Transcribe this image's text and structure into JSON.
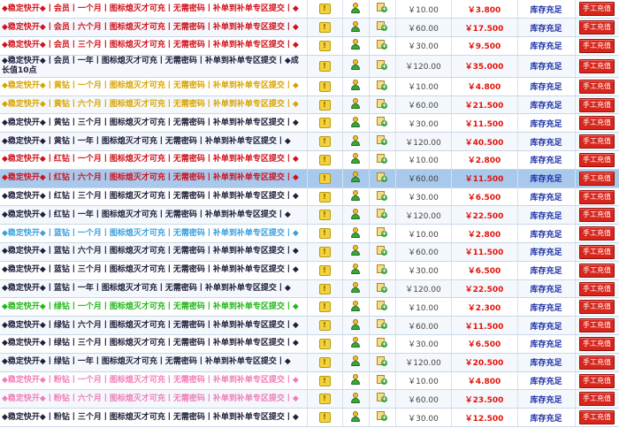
{
  "window": {
    "title": ""
  },
  "stock_status": "库存充足",
  "recharge_button_label": "手工充值",
  "colors": {
    "red": "#d0121c",
    "gold": "#d9a400",
    "dark": "#20203c",
    "sky": "#3aa0de",
    "green": "#22b818",
    "pink": "#f07fb8",
    "sell_price": "#e0140a",
    "stock": "#1a2fa8",
    "selected_row": "#a8c8ec",
    "button": "#d8261c"
  },
  "icons": {
    "notice": "exclamation-icon",
    "user": "user-icon",
    "add": "add-document-icon"
  },
  "rows": [
    {
      "name": "◆稳定快开◆丨会员丨一个月丨图标熄灭才可充丨无需密码丨补单到补单专区提交丨◆",
      "color": "red",
      "price": "￥10.00",
      "sell": "￥3.800"
    },
    {
      "name": "◆稳定快开◆丨会员丨六个月丨图标熄灭才可充丨无需密码丨补单到补单专区提交丨◆",
      "color": "red",
      "price": "￥60.00",
      "sell": "￥17.500"
    },
    {
      "name": "◆稳定快开◆丨会员丨三个月丨图标熄灭才可充丨无需密码丨补单到补单专区提交丨◆",
      "color": "red",
      "price": "￥30.00",
      "sell": "￥9.500"
    },
    {
      "name": "◆稳定快开◆丨会员丨一年丨图标熄灭才可充丨无需密码丨补单到补单专区提交丨◆成长值10点",
      "color": "dark",
      "price": "￥120.00",
      "sell": "￥35.000",
      "tall": true
    },
    {
      "name": "◆稳定快开◆丨黄钻丨一个月丨图标熄灭才可充丨无需密码丨补单到补单专区提交丨◆",
      "color": "gold",
      "price": "￥10.00",
      "sell": "￥4.800"
    },
    {
      "name": "◆稳定快开◆丨黄钻丨六个月丨图标熄灭才可充丨无需密码丨补单到补单专区提交丨◆",
      "color": "gold",
      "price": "￥60.00",
      "sell": "￥21.500"
    },
    {
      "name": "◆稳定快开◆丨黄钻丨三个月丨图标熄灭才可充丨无需密码丨补单到补单专区提交丨◆",
      "color": "dark",
      "price": "￥30.00",
      "sell": "￥11.500"
    },
    {
      "name": "◆稳定快开◆丨黄钻丨一年丨图标熄灭才可充丨无需密码丨补单到补单专区提交丨◆",
      "color": "dark",
      "price": "￥120.00",
      "sell": "￥40.500"
    },
    {
      "name": "◆稳定快开◆丨红钻丨一个月丨图标熄灭才可充丨无需密码丨补单到补单专区提交丨◆",
      "color": "red",
      "price": "￥10.00",
      "sell": "￥2.800"
    },
    {
      "name": "◆稳定快开◆丨红钻丨六个月丨图标熄灭才可充丨无需密码丨补单到补单专区提交丨◆",
      "color": "red",
      "price": "￥60.00",
      "sell": "￥11.500",
      "selected": true
    },
    {
      "name": "◆稳定快开◆丨红钻丨三个月丨图标熄灭才可充丨无需密码丨补单到补单专区提交丨◆",
      "color": "dark",
      "price": "￥30.00",
      "sell": "￥6.500"
    },
    {
      "name": "◆稳定快开◆丨红钻丨一年丨图标熄灭才可充丨无需密码丨补单到补单专区提交丨◆",
      "color": "dark",
      "price": "￥120.00",
      "sell": "￥22.500"
    },
    {
      "name": "◆稳定快开◆丨蓝钻丨一个月丨图标熄灭才可充丨无需密码丨补单到补单专区提交丨◆",
      "color": "sky",
      "price": "￥10.00",
      "sell": "￥2.800"
    },
    {
      "name": "◆稳定快开◆丨蓝钻丨六个月丨图标熄灭才可充丨无需密码丨补单到补单专区提交丨◆",
      "color": "dark",
      "price": "￥60.00",
      "sell": "￥11.500"
    },
    {
      "name": "◆稳定快开◆丨蓝钻丨三个月丨图标熄灭才可充丨无需密码丨补单到补单专区提交丨◆",
      "color": "dark",
      "price": "￥30.00",
      "sell": "￥6.500"
    },
    {
      "name": "◆稳定快开◆丨蓝钻丨一年丨图标熄灭才可充丨无需密码丨补单到补单专区提交丨◆",
      "color": "dark",
      "price": "￥120.00",
      "sell": "￥22.500"
    },
    {
      "name": "◆稳定快开◆丨绿钻丨一个月丨图标熄灭才可充丨无需密码丨补单到补单专区提交丨◆",
      "color": "green",
      "price": "￥10.00",
      "sell": "￥2.300"
    },
    {
      "name": "◆稳定快开◆丨绿钻丨六个月丨图标熄灭才可充丨无需密码丨补单到补单专区提交丨◆",
      "color": "dark",
      "price": "￥60.00",
      "sell": "￥11.500"
    },
    {
      "name": "◆稳定快开◆丨绿钻丨三个月丨图标熄灭才可充丨无需密码丨补单到补单专区提交丨◆",
      "color": "dark",
      "price": "￥30.00",
      "sell": "￥6.500"
    },
    {
      "name": "◆稳定快开◆丨绿钻丨一年丨图标熄灭才可充丨无需密码丨补单到补单专区提交丨◆",
      "color": "dark",
      "price": "￥120.00",
      "sell": "￥20.500"
    },
    {
      "name": "◆稳定快开◆丨粉钻丨一个月丨图标熄灭才可充丨无需密码丨补单到补单专区提交丨◆",
      "color": "pink",
      "price": "￥10.00",
      "sell": "￥4.800"
    },
    {
      "name": "◆稳定快开◆丨粉钻丨六个月丨图标熄灭才可充丨无需密码丨补单到补单专区提交丨◆",
      "color": "pink",
      "price": "￥60.00",
      "sell": "￥23.500"
    },
    {
      "name": "◆稳定快开◆丨粉钻丨三个月丨图标熄灭才可充丨无需密码丨补单到补单专区提交丨◆",
      "color": "dark",
      "price": "￥30.00",
      "sell": "￥12.500"
    }
  ]
}
